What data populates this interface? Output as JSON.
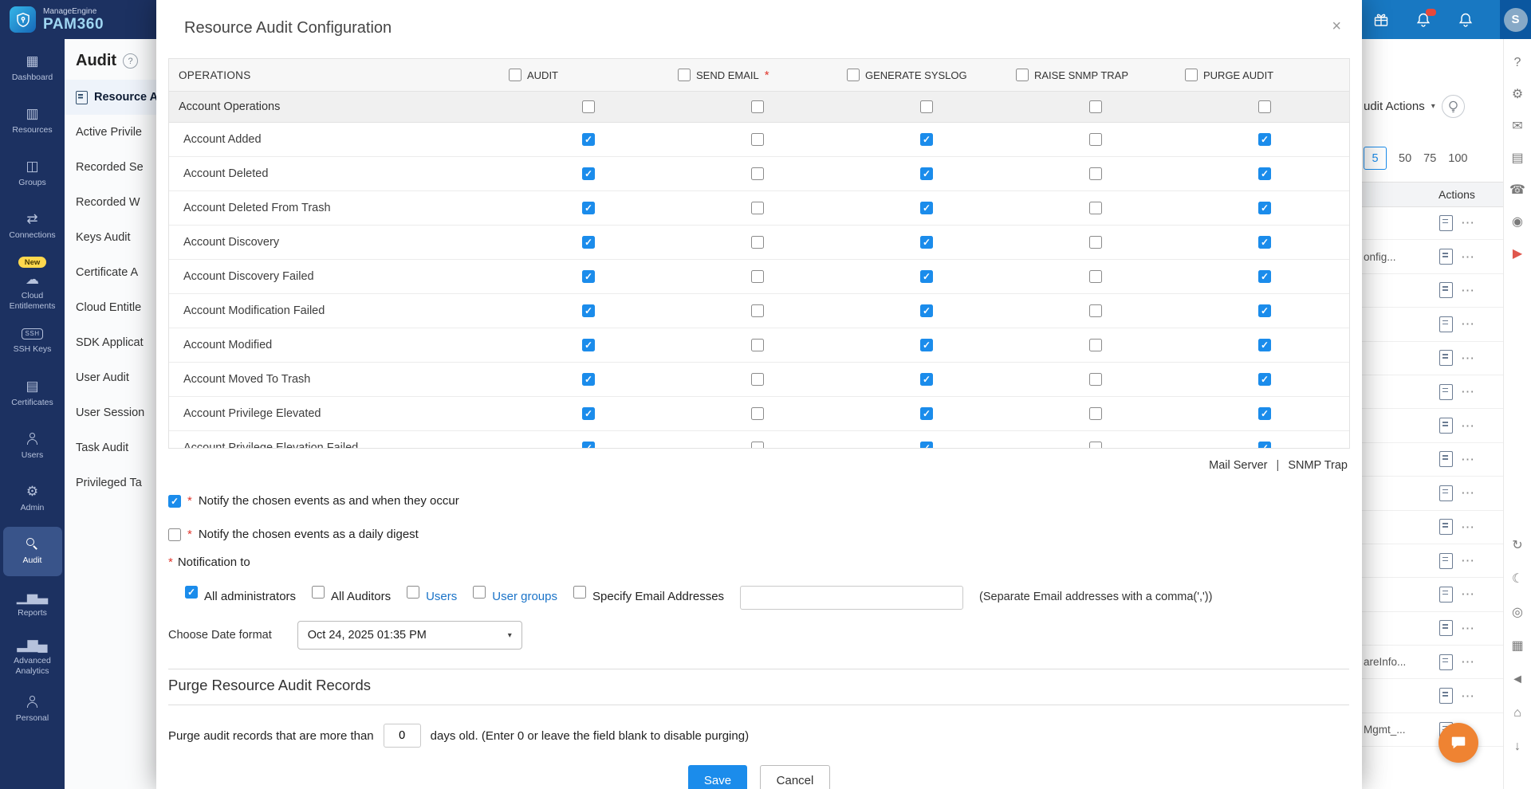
{
  "colors": {
    "sidebar_bg": "#1c3161",
    "topbar_bg": "#1878c2",
    "accent_blue": "#1b8ceb",
    "checkbox_blue": "#1b8ceb",
    "link_blue": "#1a73c8",
    "required_red": "#e0352b",
    "save_blue": "#1b8ceb",
    "badge_yellow": "#ffd84d",
    "chat_orange": "#ef8332",
    "avatar_square": "#0b57a0",
    "rail_red": "#e0574d"
  },
  "icons": {
    "help": "?",
    "close": "×",
    "chevron_down": "▾",
    "more": "⋯"
  },
  "brand": {
    "line1": "ManageEngine",
    "line2": "PAM360"
  },
  "topbar": {
    "avatar_initial": "S"
  },
  "left_nav": {
    "items": [
      {
        "label": "Dashboard",
        "icon": "dashboard-icon",
        "glyph": "▦"
      },
      {
        "label": "Resources",
        "icon": "resources-icon",
        "glyph": "▥"
      },
      {
        "label": "Groups",
        "icon": "groups-icon",
        "glyph": "◫"
      },
      {
        "label": "Connections",
        "icon": "connections-icon",
        "glyph": "⇄"
      },
      {
        "label": "Cloud Entitlements",
        "icon": "cloud-icon",
        "glyph": "☁",
        "badge": "New"
      },
      {
        "label": "SSH Keys",
        "icon": "ssh-keys-icon",
        "glyph": "SSH"
      },
      {
        "label": "Certificates",
        "icon": "certificates-icon",
        "glyph": "▤"
      },
      {
        "label": "Users",
        "icon": "users-icon",
        "shape": "person"
      },
      {
        "label": "Admin",
        "icon": "admin-gear-icon",
        "glyph": "⚙"
      },
      {
        "label": "Audit",
        "icon": "audit-magnifier-icon",
        "shape": "magnifier",
        "active": true
      },
      {
        "label": "Reports",
        "icon": "reports-icon",
        "glyph": "▁▅▃"
      },
      {
        "label": "Advanced Analytics",
        "icon": "analytics-icon",
        "glyph": "▂▆▄"
      },
      {
        "label": "Personal",
        "icon": "personal-icon",
        "shape": "person"
      }
    ]
  },
  "audit_panel": {
    "title": "Audit",
    "items": [
      {
        "label": "Resource Au",
        "selected": true
      },
      {
        "label": "Active Privile"
      },
      {
        "label": "Recorded Se"
      },
      {
        "label": "Recorded W"
      },
      {
        "label": "Keys Audit"
      },
      {
        "label": "Certificate A"
      },
      {
        "label": "Cloud Entitle"
      },
      {
        "label": "SDK Applicat"
      },
      {
        "label": "User Audit"
      },
      {
        "label": "User Session"
      },
      {
        "label": "Task Audit"
      },
      {
        "label": "Privileged Ta"
      }
    ]
  },
  "background": {
    "actions_button": "udit Actions",
    "pagination": [
      {
        "label": "5",
        "boxed": true
      },
      {
        "label": "50"
      },
      {
        "label": "75"
      },
      {
        "label": "100"
      }
    ],
    "column_header": "Actions",
    "rows": [
      {
        "fragment": ""
      },
      {
        "fragment": "onfig..."
      },
      {
        "fragment": ""
      },
      {
        "fragment": ""
      },
      {
        "fragment": ""
      },
      {
        "fragment": ""
      },
      {
        "fragment": ""
      },
      {
        "fragment": ""
      },
      {
        "fragment": ""
      },
      {
        "fragment": ""
      },
      {
        "fragment": ""
      },
      {
        "fragment": ""
      },
      {
        "fragment": ""
      },
      {
        "fragment": "areInfo..."
      },
      {
        "fragment": ""
      },
      {
        "fragment": "Mgmt_..."
      }
    ]
  },
  "right_rail": {
    "top_icons": [
      {
        "name": "help-icon",
        "glyph": "?"
      },
      {
        "name": "setup-icon",
        "glyph": "⚙"
      },
      {
        "name": "mail-icon",
        "glyph": "✉"
      },
      {
        "name": "requests-icon",
        "glyph": "▤"
      },
      {
        "name": "phone-icon",
        "glyph": "☎"
      },
      {
        "name": "record-icon",
        "glyph": "◉"
      },
      {
        "name": "video-icon",
        "glyph": "▶",
        "color": "#e0574d"
      }
    ],
    "bottom_icons": [
      {
        "name": "refresh-icon",
        "glyph": "↻"
      },
      {
        "name": "night-mode-icon",
        "glyph": "☾"
      },
      {
        "name": "support-icon",
        "glyph": "◎"
      },
      {
        "name": "apps-icon",
        "glyph": "▦"
      },
      {
        "name": "announcement-icon",
        "glyph": "◄"
      },
      {
        "name": "home-icon",
        "glyph": "⌂"
      },
      {
        "name": "download-icon",
        "glyph": "↓"
      }
    ]
  },
  "modal": {
    "title": "Resource Audit Configuration",
    "close_glyph": "×",
    "required_mark": "*",
    "table": {
      "operations_header": "OPERATIONS",
      "columns": [
        {
          "label": "AUDIT"
        },
        {
          "label": "SEND EMAIL",
          "required": true
        },
        {
          "label": "GENERATE SYSLOG"
        },
        {
          "label": "RAISE SNMP TRAP"
        },
        {
          "label": "PURGE AUDIT"
        }
      ],
      "group_row": {
        "label": "Account Operations",
        "checks": [
          false,
          false,
          false,
          false,
          false
        ]
      },
      "rows": [
        {
          "label": "Account Added",
          "checks": [
            true,
            false,
            true,
            false,
            true
          ]
        },
        {
          "label": "Account Deleted",
          "checks": [
            true,
            false,
            true,
            false,
            true
          ]
        },
        {
          "label": "Account Deleted From Trash",
          "checks": [
            true,
            false,
            true,
            false,
            true
          ]
        },
        {
          "label": "Account Discovery",
          "checks": [
            true,
            false,
            true,
            false,
            true
          ]
        },
        {
          "label": "Account Discovery Failed",
          "checks": [
            true,
            false,
            true,
            false,
            true
          ]
        },
        {
          "label": "Account Modification Failed",
          "checks": [
            true,
            false,
            true,
            false,
            true
          ]
        },
        {
          "label": "Account Modified",
          "checks": [
            true,
            false,
            true,
            false,
            true
          ]
        },
        {
          "label": "Account Moved To Trash",
          "checks": [
            true,
            false,
            true,
            false,
            true
          ]
        },
        {
          "label": "Account Privilege Elevated",
          "checks": [
            true,
            false,
            true,
            false,
            true
          ]
        },
        {
          "label": "Account Privilege Elevation Failed",
          "checks": [
            true,
            false,
            true,
            false,
            true
          ]
        }
      ]
    },
    "links": {
      "mail_server": "Mail Server",
      "separator": "|",
      "snmp_trap": "SNMP Trap"
    },
    "notify": {
      "occur_label": "Notify the chosen events as and when they occur",
      "occur_checked": true,
      "digest_label": "Notify the chosen events as a daily digest",
      "digest_checked": false,
      "notification_to": "Notification to",
      "recipients": [
        {
          "label": "All administrators",
          "checked": true
        },
        {
          "label": "All Auditors",
          "checked": false
        },
        {
          "label": "Users",
          "checked": false,
          "link": true
        },
        {
          "label": "User groups",
          "checked": false,
          "link": true
        },
        {
          "label": "Specify Email Addresses",
          "checked": false
        }
      ],
      "email_hint": "(Separate Email addresses with a comma(','))"
    },
    "date_format": {
      "label": "Choose Date format",
      "value": "Oct 24, 2025 01:35 PM"
    },
    "purge": {
      "heading": "Purge Resource Audit Records",
      "text_before": "Purge audit records that are more than",
      "value": "0",
      "text_after": "days old. (Enter 0 or leave the field blank to disable purging)"
    },
    "buttons": {
      "save": "Save",
      "cancel": "Cancel"
    }
  }
}
